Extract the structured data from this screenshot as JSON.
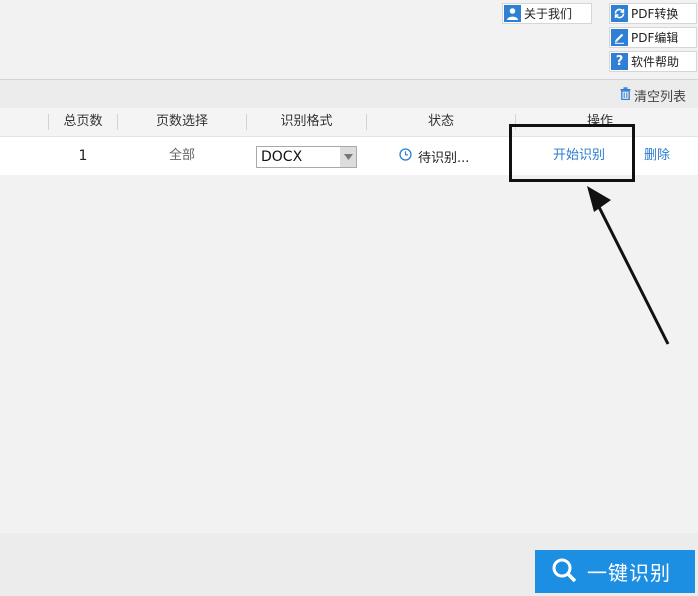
{
  "header": {
    "buttons": [
      {
        "label": "关于我们",
        "icon": "user-icon"
      },
      {
        "label": "PDF转换",
        "icon": "refresh-icon"
      },
      {
        "label": "PDF编辑",
        "icon": "pencil-icon"
      },
      {
        "label": "软件帮助",
        "icon": "question-icon"
      }
    ]
  },
  "toolbar": {
    "clear_label": "清空列表",
    "clear_icon": "trash-icon"
  },
  "table": {
    "columns": [
      "总页数",
      "页数选择",
      "识别格式",
      "状态",
      "操作"
    ],
    "rows": [
      {
        "total_pages": "1",
        "page_selection": "全部",
        "format": "DOCX",
        "status": "待识别...",
        "status_icon": "clock-icon",
        "action_start": "开始识别",
        "action_delete": "删除"
      }
    ]
  },
  "footer": {
    "main_button_label": "一键识别",
    "main_button_icon": "search-icon"
  },
  "colors": {
    "accent": "#1d8fe3",
    "link": "#2a7ccf",
    "icon_blue": "#2f7fd4",
    "annotation": "#111111"
  }
}
